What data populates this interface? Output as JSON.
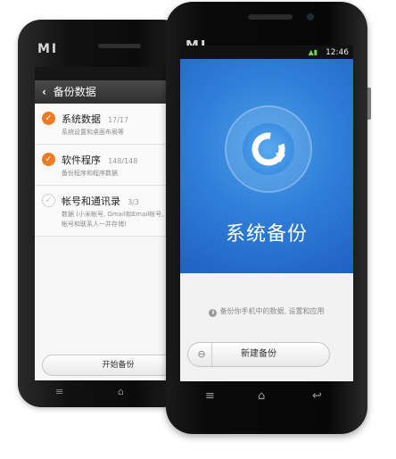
{
  "back_phone": {
    "brand": "MI",
    "title": "备份数据",
    "items": [
      {
        "title": "系统数据",
        "count": "17/17",
        "desc": "系统设置和桌面布局等",
        "checked": true
      },
      {
        "title": "软件程序",
        "count": "148/148",
        "desc": "备份程序和程序数据",
        "checked": true
      },
      {
        "title": "帐号和通讯录",
        "count": "3/3",
        "desc": "数据 (小米帐号, Gmail和Email帐号, 微博帐号和联系人一并存储)",
        "checked": false
      }
    ],
    "start_button": "开始备份",
    "nav": {
      "menu": "≡",
      "home": "⌂"
    }
  },
  "front_phone": {
    "brand": "MI",
    "status": {
      "time": "12:46"
    },
    "hero_title": "系统备份",
    "info_text": "备份你手机中的数据, 设置和应用",
    "new_backup_button": "新建备份",
    "nav": {
      "menu": "≡",
      "home": "⌂",
      "back": "↩"
    }
  },
  "colors": {
    "accent_orange": "#ee7a24",
    "hero_blue": "#2f7fd9"
  }
}
